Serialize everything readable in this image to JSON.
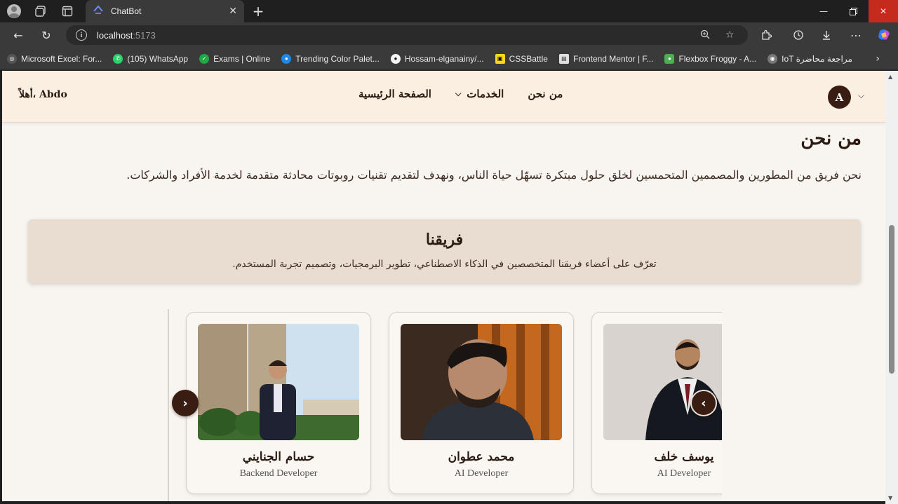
{
  "browser": {
    "tab_title": "ChatBot",
    "url_host": "localhost",
    "url_port": ":5173",
    "bookmarks": [
      {
        "label": "Microsoft Excel: For...",
        "color": "#555555"
      },
      {
        "label": "(105) WhatsApp",
        "color": "#25d366"
      },
      {
        "label": "Exams | Online",
        "color": "#22a845"
      },
      {
        "label": "Trending Color Palet...",
        "color": "#1e88e5"
      },
      {
        "label": "Hossam-elganainy/...",
        "color": "#222222"
      },
      {
        "label": "CSSBattle",
        "color": "#f9d71c"
      },
      {
        "label": "Frontend Mentor | F...",
        "color": "#e0e0e0"
      },
      {
        "label": "Flexbox Froggy - A...",
        "color": "#4caf50"
      },
      {
        "label": "IoT مراجعة محاضرة",
        "color": "#777777"
      }
    ]
  },
  "header": {
    "greeting": "أهلاً، Abdo",
    "nav": {
      "home": "الصفحة الرئيسية",
      "services": "الخدمات",
      "about": "من نحن"
    },
    "avatar_letter": "A"
  },
  "about": {
    "title": "من نحن",
    "text": "نحن فريق من المطورين والمصممين المتحمسين لخلق حلول مبتكرة تسهّل حياة الناس، ونهدف لتقديم تقنيات روبوتات محادثة متقدمة لخدمة الأفراد والشركات."
  },
  "team": {
    "title": "فريقنا",
    "subtitle": "تعرّف على أعضاء فريقنا المتخصصين في الذكاء الاصطناعي، تطوير البرمجيات، وتصميم تجربة المستخدم."
  },
  "members": [
    {
      "name": "حسام الجنايني",
      "role": "Backend Developer"
    },
    {
      "name": "محمد عطوان",
      "role": "AI Developer"
    },
    {
      "name": "يوسف خلف",
      "role": "AI Developer"
    }
  ],
  "colors": {
    "accent": "#3a1d12",
    "header_bg": "#faefe0",
    "page_bg": "#f8f4f0",
    "team_box_bg": "#e9ddd2"
  }
}
